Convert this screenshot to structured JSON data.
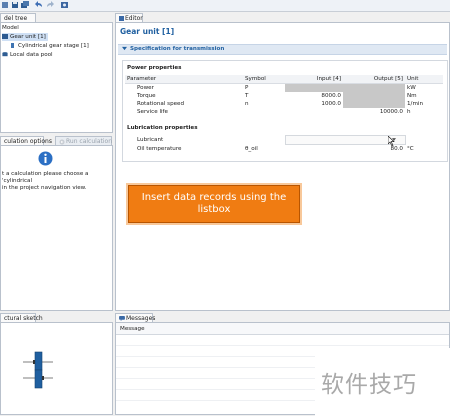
{
  "tabs": {
    "model_tree": "del tree",
    "editor": "Editor",
    "calc_options": "culation options",
    "run_calc": "Run calculation",
    "sketch": "ctural sketch",
    "messages": "Messages"
  },
  "tree": {
    "root": "Model",
    "items": [
      {
        "label": "Gear unit [1]",
        "selected": true
      },
      {
        "label": "Cylindrical gear stage [1]",
        "selected": false
      },
      {
        "label": "Local data pool",
        "selected": false
      }
    ]
  },
  "calc_options": {
    "message_line1": "t a calculation please choose a 'cylindrical",
    "message_line2": "in the project navigation view."
  },
  "editor": {
    "title": "Gear unit [1]",
    "section": "Specification for transmission",
    "power_group": "Power properties",
    "columns": [
      "Parameter",
      "Symbol",
      "Input [4]",
      "Output [5]",
      "Unit"
    ],
    "rows": [
      {
        "param": "Power",
        "symbol": "P",
        "input": "",
        "output": "",
        "unit": "kW"
      },
      {
        "param": "Torque",
        "symbol": "T",
        "input": "8000.0",
        "output": "",
        "unit": "Nm"
      },
      {
        "param": "Rotational speed",
        "symbol": "n",
        "input": "1000.0",
        "output": "",
        "unit": "1/min"
      },
      {
        "param": "Service life",
        "symbol": "",
        "input": "",
        "output": "10000.0",
        "unit": "h"
      }
    ],
    "lub_group": "Lubrication properties",
    "lub_rows": [
      {
        "param": "Lubricant",
        "symbol": "",
        "value": "",
        "unit": ""
      },
      {
        "param": "Oil temperature",
        "symbol": "θ_oil",
        "value": "80.0",
        "unit": "°C"
      }
    ]
  },
  "callout": {
    "line1": "Insert data records using the",
    "line2": "listbox"
  },
  "messages": {
    "header": "Message"
  },
  "watermark": "软件技巧",
  "colors": {
    "accent": "#1f5fa0",
    "callout_bg": "#f07c12",
    "section_bg": "#dfe8f3"
  }
}
